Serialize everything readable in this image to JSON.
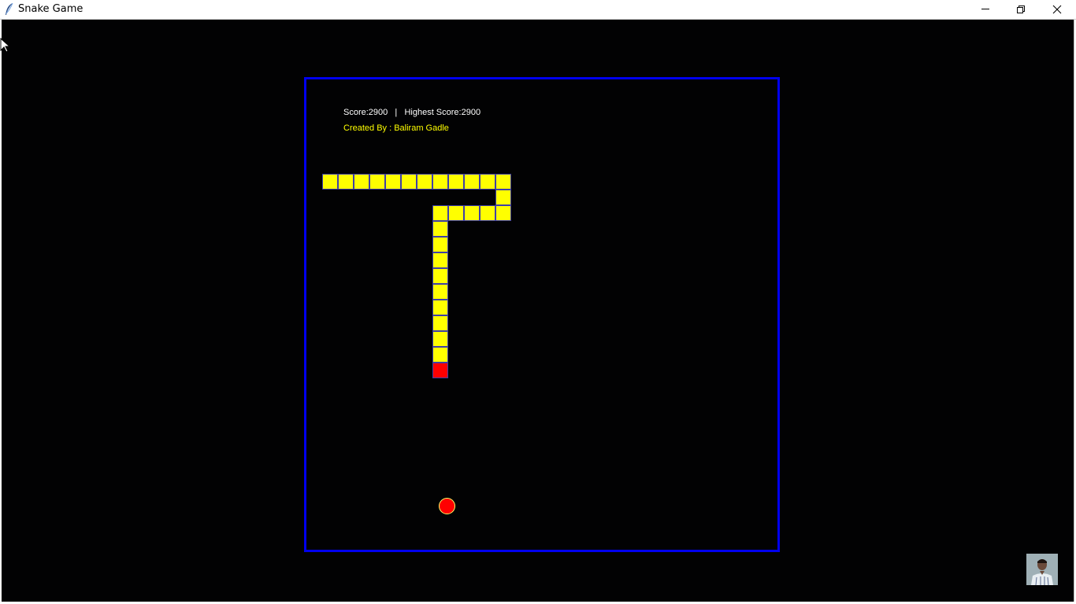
{
  "window": {
    "title": "Snake Game",
    "icons": {
      "app": "feather-icon",
      "minimize": "minimize-icon",
      "maximize": "restore-icon",
      "close": "close-icon"
    }
  },
  "hud": {
    "score_text": "Score:2900   |   Highest Score:2900",
    "credit_text": "Created By : Baliram Gadle"
  },
  "game": {
    "grid_cell": 20,
    "snake": [
      [
        1,
        6
      ],
      [
        2,
        6
      ],
      [
        3,
        6
      ],
      [
        4,
        6
      ],
      [
        5,
        6
      ],
      [
        6,
        6
      ],
      [
        7,
        6
      ],
      [
        8,
        6
      ],
      [
        9,
        6
      ],
      [
        10,
        6
      ],
      [
        11,
        6
      ],
      [
        12,
        6
      ],
      [
        12,
        7
      ],
      [
        12,
        8
      ],
      [
        11,
        8
      ],
      [
        10,
        8
      ],
      [
        9,
        8
      ],
      [
        8,
        8
      ],
      [
        8,
        9
      ],
      [
        8,
        10
      ],
      [
        8,
        11
      ],
      [
        8,
        12
      ],
      [
        8,
        13
      ],
      [
        8,
        14
      ],
      [
        8,
        15
      ],
      [
        8,
        16
      ],
      [
        8,
        17
      ],
      [
        8,
        18
      ]
    ],
    "food": [
      8.4,
      26.6
    ],
    "colors": {
      "background": "#020203",
      "border": "#0000ee",
      "snake_body": "#ffff00",
      "snake_head": "#ff0000",
      "food": "#ff0000",
      "score_text": "#ffffff",
      "credit_text": "#ffff00"
    }
  }
}
